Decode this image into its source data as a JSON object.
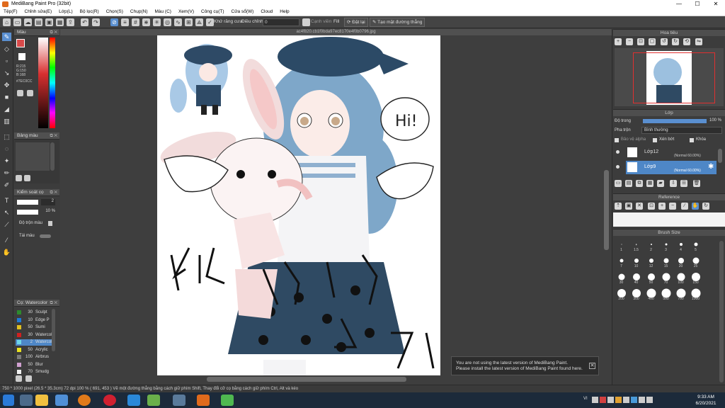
{
  "window": {
    "title": "MediBang Paint Pro (32bit)",
    "minimize": "—",
    "maximize": "☐",
    "close": "✕"
  },
  "menu": [
    "Tệp(F)",
    "Chỉnh sửa(E)",
    "Lớp(L)",
    "Bộ lọc(R)",
    "Chọn(S)",
    "Chụp(N)",
    "Màu (C)",
    "Xem(V)",
    "Công cụ(T)",
    "Cửa sổ(W)",
    "Cloud",
    "Help"
  ],
  "toolbar": {
    "antialias_label": "Khử răng cưa",
    "correction_label": "Điều chỉnh",
    "correction_value": "0",
    "edge_label": "Cạnh viền",
    "fill_label": "Fill",
    "fill_button": "Đặt lại",
    "perspective_button": "Tạo mặt đường thẳng"
  },
  "color_panel": {
    "title": "Màu",
    "rgb_r": "R:215",
    "rgb_g": "G:150",
    "rgb_b": "B:168",
    "hex": "#7EC0CC"
  },
  "brush_color_panel": {
    "title": "Bảng màu"
  },
  "brush_control": {
    "title": "Kiểm soát cọ",
    "size_value": "2",
    "opacity_value": "10 %",
    "blend_label": "Độ trộn màu",
    "stabilizer_label": "Tái màu"
  },
  "brush_list": {
    "title": "Cọ: Watercolor",
    "items": [
      {
        "size": "30",
        "name": "Sculpt",
        "color": "#2d8a2d"
      },
      {
        "size": "10",
        "name": "Edge P",
        "color": "#1e7ad6"
      },
      {
        "size": "50",
        "name": "Sumi",
        "color": "#e0c020"
      },
      {
        "size": "30",
        "name": "Watercol",
        "color": "#d02020"
      },
      {
        "size": "2",
        "name": "Watercol",
        "color": "#6fd6e8"
      },
      {
        "size": "50",
        "name": "Acrylic",
        "color": "#e8e020"
      },
      {
        "size": "100",
        "name": "Airbrus",
        "color": "#7a7a7a"
      },
      {
        "size": "50",
        "name": "Blur",
        "color": "#d0a0d0"
      },
      {
        "size": "70",
        "name": "Smudg",
        "color": "#f0f0f0"
      }
    ]
  },
  "document": {
    "tab": "ac4f820.cb1f0bda97ec8170e4f0b0796.jpg",
    "speech_text": "Hi!"
  },
  "navigator": {
    "title": "Hoa tiêu"
  },
  "layers": {
    "title": "Lớp",
    "opacity_label": "Độ trong",
    "opacity_value": "100 %",
    "blend_label": "Pha trộn",
    "blend_value": "Bình thường",
    "protect_alpha": "Bảo vệ alpha",
    "clipping": "Xén bớt",
    "lock": "Khóa",
    "items": [
      {
        "name": "Lớp12",
        "meta": "(Normal 60.00%)"
      },
      {
        "name": "Lớp9",
        "meta": "(Normal 60.00%)"
      }
    ]
  },
  "reference": {
    "title": "Reference"
  },
  "brush_size": {
    "title": "Brush Size",
    "sizes": [
      "1",
      "1.5",
      "2",
      "3",
      "4",
      "5",
      "7",
      "10",
      "12",
      "15",
      "20",
      "25",
      "30",
      "40",
      "50",
      "70",
      "100",
      "150",
      "200",
      "300",
      "400",
      "500",
      "700",
      "1000"
    ]
  },
  "notice": {
    "line1": "You are not using the latest version of MediBang Paint.",
    "line2": "Please install the latest version of MediBang Paint found here."
  },
  "status": {
    "text": "750 * 1000 pixel  (26.5 * 35.3cm)  72 dpi  100 %  ( 691, 453 )  Vẽ một đường thẳng bằng cách giữ phím Shift, Thay đổi cỡ cọ bằng cách giữ phím Ctrl, Alt và kéo"
  },
  "taskbar": {
    "time": "9:33 AM",
    "date": "6/20/2021",
    "lang": "VI"
  }
}
